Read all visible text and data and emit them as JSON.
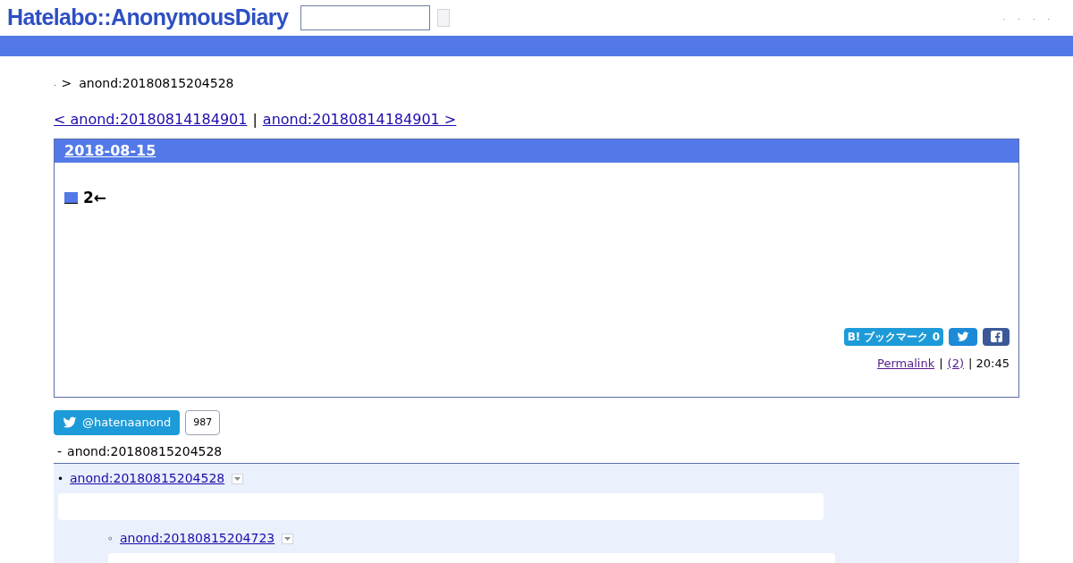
{
  "header": {
    "logo": "Hatelabo::AnonymousDiary",
    "links": [
      ".",
      ".",
      ".",
      "."
    ]
  },
  "breadcrumb": {
    "home": ".",
    "separator": ">",
    "current": "anond:20180815204528"
  },
  "pager": {
    "prev": "< anond:20180814184901",
    "separator": "|",
    "next": "anond:20180814184901 >"
  },
  "entry": {
    "date": "2018-08-15",
    "title": "2←",
    "bookmark": "B! ブックマーク 0",
    "footer": [
      {
        "kind": "link",
        "text": "Permalink"
      },
      {
        "kind": "text",
        "text": "|"
      },
      {
        "kind": "link",
        "text": "(2)"
      },
      {
        "kind": "text",
        "text": "| 20:45"
      }
    ]
  },
  "follow": {
    "label": "@hatenaanond",
    "count": "987"
  },
  "tree": {
    "heading": "anond:20180815204528",
    "marker": "-",
    "items": [
      {
        "marker": "•",
        "label": "anond:20180815204528",
        "children": [
          {
            "marker": "◦",
            "label": "anond:20180815204723"
          }
        ]
      }
    ]
  }
}
